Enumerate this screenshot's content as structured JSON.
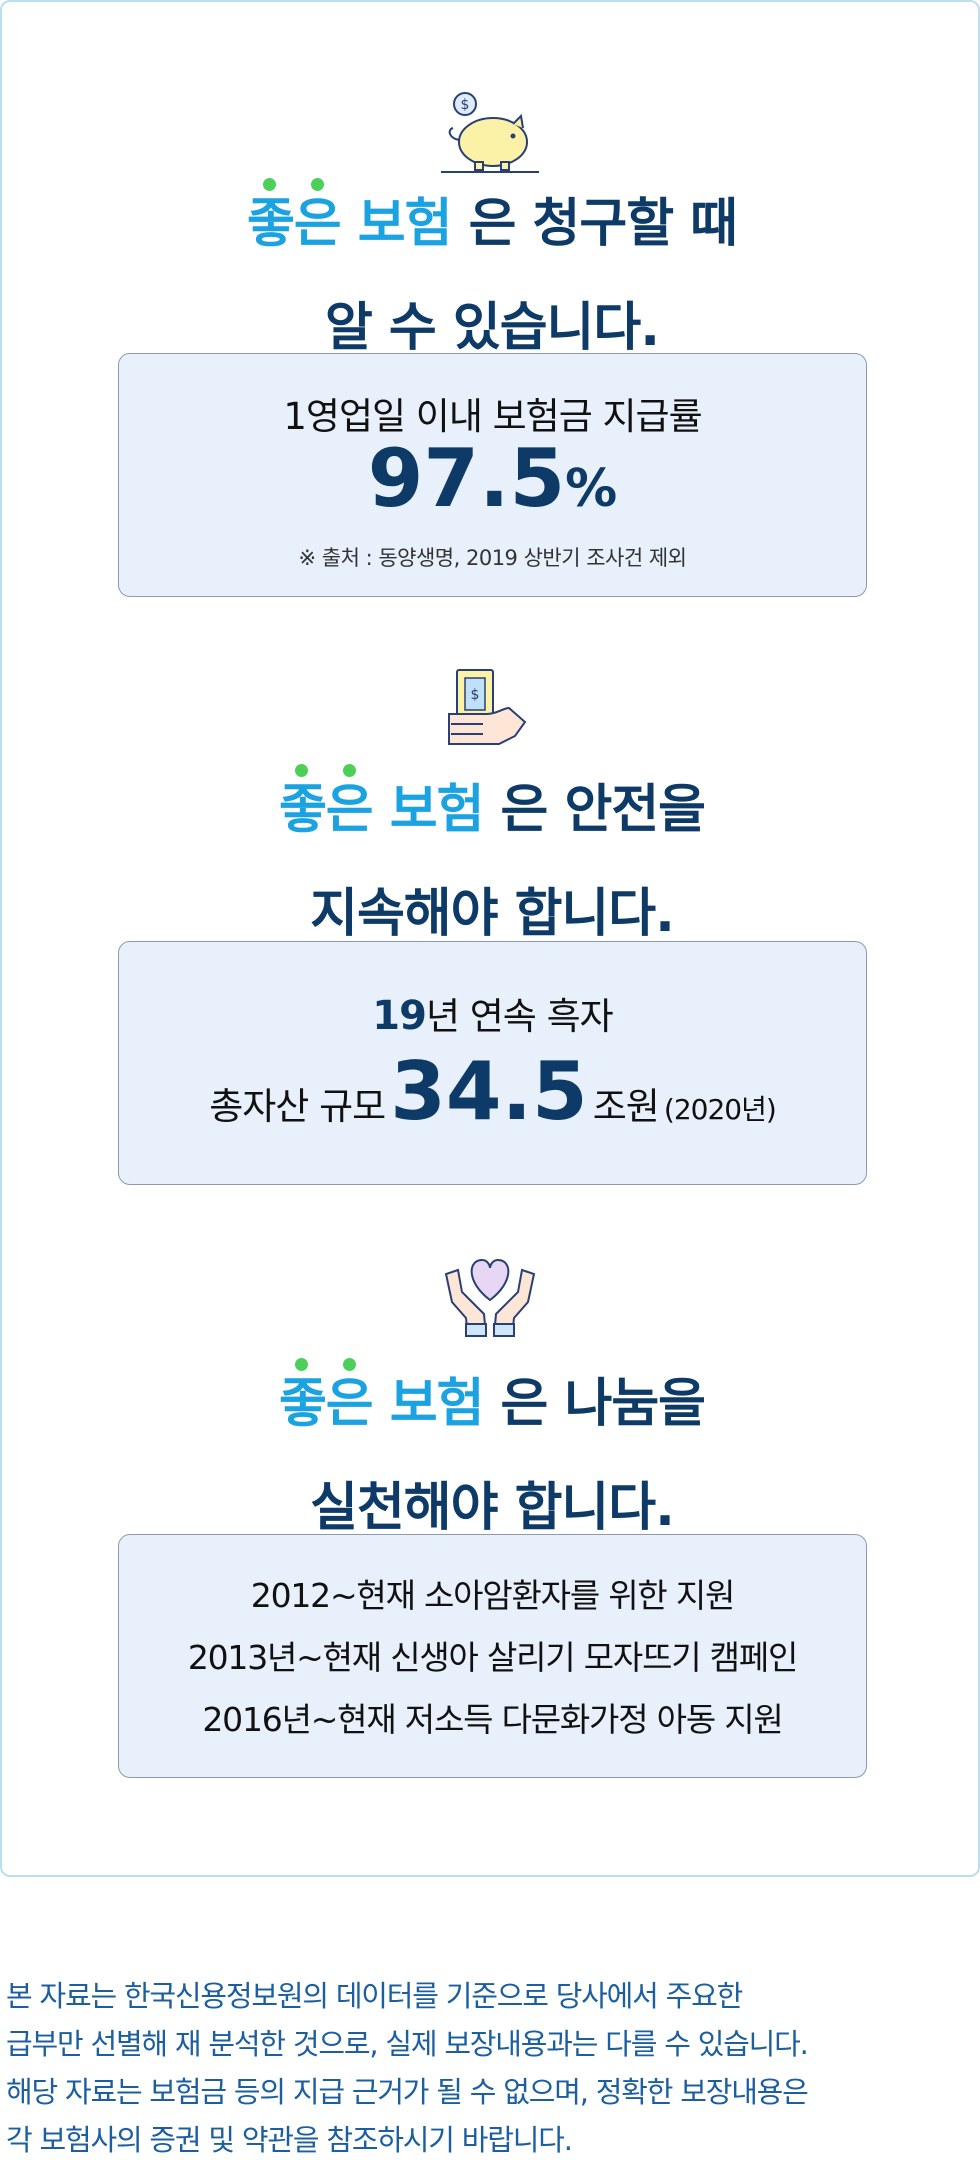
{
  "sections": [
    {
      "headline": {
        "highlight": "좋은 보험",
        "rest_line1": "은 청구할 때",
        "line2": "알 수 있습니다."
      },
      "box": {
        "label": "1영업일 이내 보험금 지급률",
        "value": "97.5",
        "unit": "%",
        "note": "※ 출처 : 동양생명, 2019 상반기 조사건 제외"
      },
      "icon": "piggy-bank-icon"
    },
    {
      "headline": {
        "highlight": "좋은 보험",
        "rest_line1": "은 안전을",
        "line2": "지속해야 합니다."
      },
      "box": {
        "line1_num": "19",
        "line1_text": "년 연속 흑자",
        "line2_prefix": "총자산 규모",
        "line2_value": "34.5",
        "line2_unit": "조원",
        "line2_suffix": "(2020년)"
      },
      "icon": "hand-holding-money-icon"
    },
    {
      "headline": {
        "highlight": "좋은 보험",
        "rest_line1": "은 나눔을",
        "line2": "실천해야 합니다."
      },
      "box": {
        "items": [
          "2012~현재 소아암환자를 위한 지원",
          "2013년~현재 신생아 살리기 모자뜨기 캠페인",
          "2016년~현재 저소득 다문화가정 아동 지원"
        ]
      },
      "icon": "hands-holding-heart-icon"
    }
  ],
  "disclaimer": {
    "lines": [
      "본 자료는 한국신용정보원의 데이터를 기준으로 당사에서 주요한",
      "급부만 선별해 재 분석한 것으로, 실제 보장내용과는 다를 수 있습니다.",
      "해당 자료는 보험금 등의 지급 근거가 될 수 없으며, 정확한 보장내용은",
      "각 보험사의 증권 및 약관을 참조하시기 바랍니다."
    ]
  },
  "colors": {
    "navy": "#0d3a66",
    "highlight_blue": "#1aa3e0",
    "dot_green": "#4cd05a",
    "box_bg": "#e8f0fb",
    "disclaimer_blue": "#1c5fa0"
  }
}
